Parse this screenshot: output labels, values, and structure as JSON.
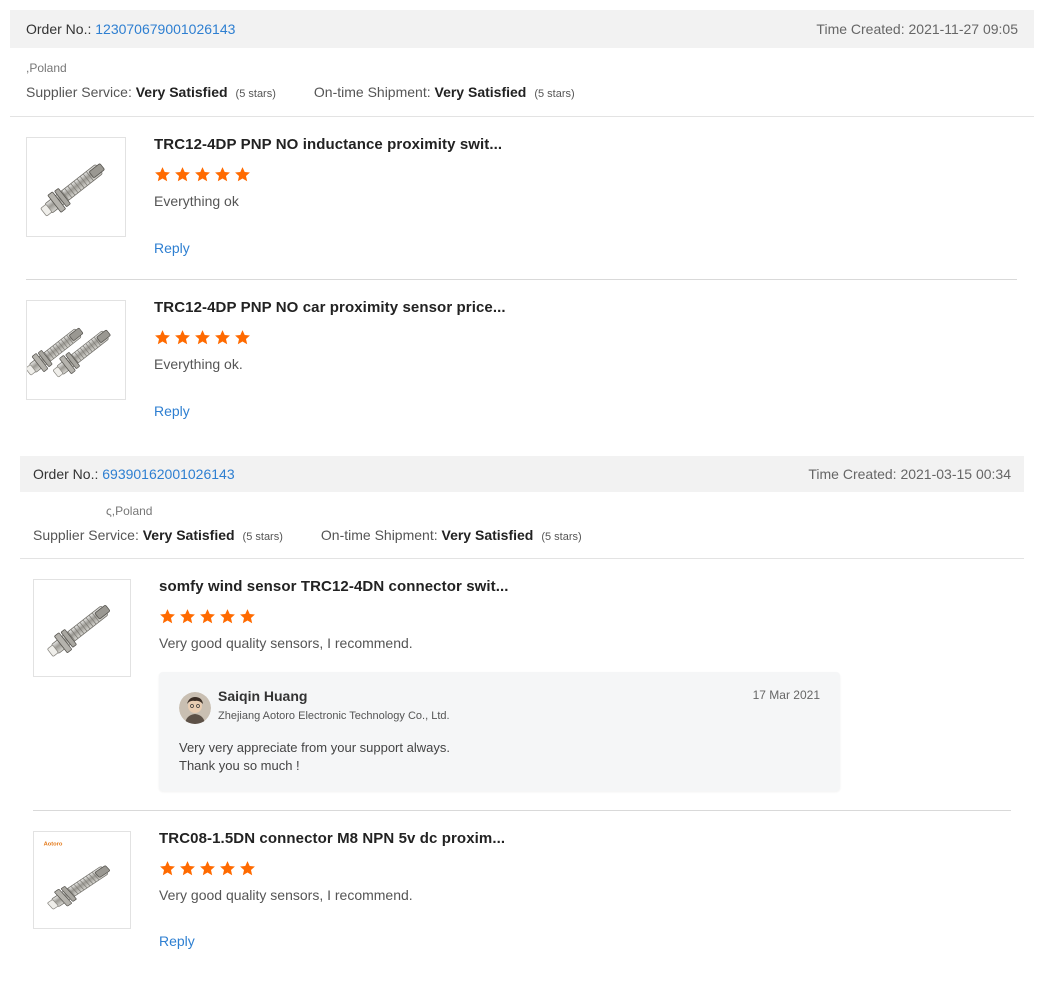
{
  "colors": {
    "accent_link": "#2e7fd1",
    "star": "#ff6a00",
    "bar_bg": "#f2f2f2"
  },
  "orders": [
    {
      "order_label": "Order No.:",
      "order_no": "123070679001026143",
      "time_label": "Time Created:",
      "time": "2021-11-27 09:05",
      "country": ",Poland",
      "supplier_label": "Supplier Service:",
      "supplier_value": "Very Satisfied",
      "supplier_stars": "(5 stars)",
      "shipment_label": "On-time Shipment:",
      "shipment_value": "Very Satisfied",
      "shipment_stars": "(5 stars)",
      "items": [
        {
          "title": "TRC12-4DP PNP NO inductance proximity swit...",
          "rating": 5,
          "review": "Everything ok",
          "reply_label": "Reply",
          "thumb_icon": "sensor-single-icon"
        },
        {
          "title": "TRC12-4DP PNP NO car proximity sensor price...",
          "rating": 5,
          "review": "Everything ok.",
          "reply_label": "Reply",
          "thumb_icon": "sensor-pair-icon"
        }
      ]
    },
    {
      "order_label": "Order No.:",
      "order_no": "69390162001026143",
      "time_label": "Time Created:",
      "time": "2021-03-15 00:34",
      "country": "ς,Poland",
      "supplier_label": "Supplier Service:",
      "supplier_value": "Very Satisfied",
      "supplier_stars": "(5 stars)",
      "shipment_label": "On-time Shipment:",
      "shipment_value": "Very Satisfied",
      "shipment_stars": "(5 stars)",
      "items": [
        {
          "title": "somfy wind sensor TRC12-4DN connector swit...",
          "rating": 5,
          "review": "Very good quality sensors, I recommend.",
          "thumb_icon": "sensor-single-icon",
          "seller_reply": {
            "name": "Saiqin Huang",
            "company": "Zhejiang Aotoro Electronic Technology Co., Ltd.",
            "date": "17 Mar 2021",
            "line1": "Very very appreciate from your support always.",
            "line2": "Thank you so much !"
          }
        },
        {
          "title": "TRC08-1.5DN connector M8 NPN 5v dc proxim...",
          "rating": 5,
          "review": "Very good quality sensors, I recommend.",
          "reply_label": "Reply",
          "thumb_icon": "sensor-thin-icon",
          "brand": "Aotoro"
        }
      ]
    }
  ]
}
